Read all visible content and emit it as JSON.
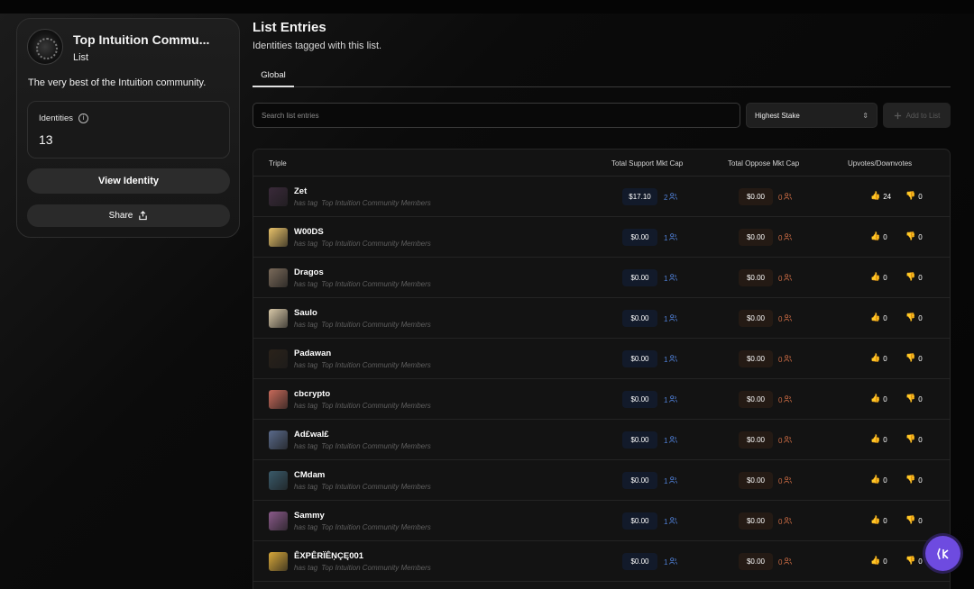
{
  "list_card": {
    "title": "Top Intuition Commu...",
    "subtitle": "List",
    "description": "The very best of the Intuition community.",
    "identities_label": "Identities",
    "identities_count": "13",
    "view_button": "View Identity",
    "share_button": "Share"
  },
  "main": {
    "title": "List Entries",
    "subtitle": "Identities tagged with this list.",
    "tab": "Global",
    "search_placeholder": "Search list entries",
    "sort_value": "Highest Stake",
    "add_button": "Add to List"
  },
  "table": {
    "headers": {
      "triple": "Triple",
      "support": "Total Support Mkt Cap",
      "oppose": "Total Oppose Mkt Cap",
      "votes": "Upvotes/Downvotes"
    },
    "predicate": "has tag",
    "list_name": "Top Intuition Community Members",
    "rows": [
      {
        "name": "Zet",
        "support": "$17.10",
        "support_count": "2",
        "oppose": "$0.00",
        "oppose_count": "0",
        "up": "24",
        "down": "0",
        "avatar_color": "#3a2a3a"
      },
      {
        "name": "W00DS",
        "support": "$0.00",
        "support_count": "1",
        "oppose": "$0.00",
        "oppose_count": "0",
        "up": "0",
        "down": "0",
        "avatar_color": "#e8c26a"
      },
      {
        "name": "Dragos",
        "support": "$0.00",
        "support_count": "1",
        "oppose": "$0.00",
        "oppose_count": "0",
        "up": "0",
        "down": "0",
        "avatar_color": "#7a6a5a"
      },
      {
        "name": "Saulo",
        "support": "$0.00",
        "support_count": "1",
        "oppose": "$0.00",
        "oppose_count": "0",
        "up": "0",
        "down": "0",
        "avatar_color": "#d8c8a8"
      },
      {
        "name": "Padawan",
        "support": "$0.00",
        "support_count": "1",
        "oppose": "$0.00",
        "oppose_count": "0",
        "up": "0",
        "down": "0",
        "avatar_color": "#2a221a"
      },
      {
        "name": "cbcrypto",
        "support": "$0.00",
        "support_count": "1",
        "oppose": "$0.00",
        "oppose_count": "0",
        "up": "0",
        "down": "0",
        "avatar_color": "#c86a5a"
      },
      {
        "name": "Ad£wal£",
        "support": "$0.00",
        "support_count": "1",
        "oppose": "$0.00",
        "oppose_count": "0",
        "up": "0",
        "down": "0",
        "avatar_color": "#5a6a8a"
      },
      {
        "name": "CMdam",
        "support": "$0.00",
        "support_count": "1",
        "oppose": "$0.00",
        "oppose_count": "0",
        "up": "0",
        "down": "0",
        "avatar_color": "#3a5a6a"
      },
      {
        "name": "Sammy",
        "support": "$0.00",
        "support_count": "1",
        "oppose": "$0.00",
        "oppose_count": "0",
        "up": "0",
        "down": "0",
        "avatar_color": "#8a5a8a"
      },
      {
        "name": "ÊXPÊRÏÊŅÇĘ001",
        "support": "$0.00",
        "support_count": "1",
        "oppose": "$0.00",
        "oppose_count": "0",
        "up": "0",
        "down": "0",
        "avatar_color": "#d8a83a"
      }
    ]
  },
  "colors": {
    "support_accent": "#4f7fd6",
    "oppose_accent": "#c86a43",
    "fab": "#6e4be0"
  },
  "icons": {
    "info": "info-icon",
    "share": "share-icon",
    "chevron": "chevron-updown-icon",
    "plus": "plus-icon",
    "users": "users-icon",
    "thumbs_up": "thumbs-up-icon",
    "thumbs_down": "thumbs-down-icon",
    "fab": "ai-assistant-icon"
  }
}
